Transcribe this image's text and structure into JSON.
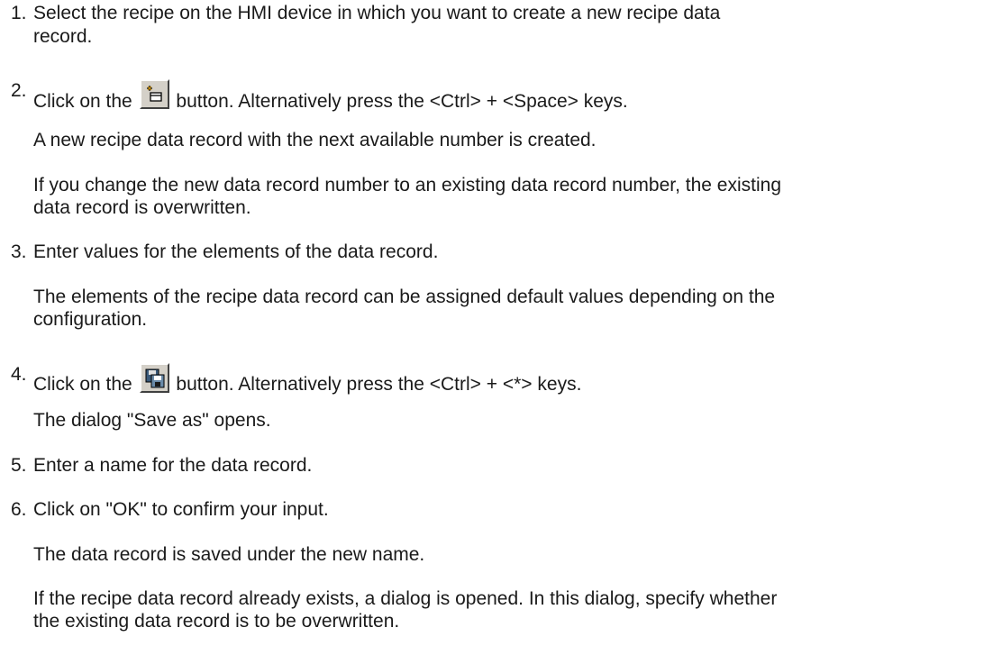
{
  "steps": [
    {
      "number": "1.",
      "lines": [
        "Select the recipe on the HMI device in which you want to create a new recipe data",
        "record."
      ]
    },
    {
      "number": "2.",
      "before": "Click on the",
      "after": "button. Alternatively press the <Ctrl> + <Space> keys.",
      "icon": "new-record-icon"
    },
    {
      "number": "3.",
      "text": "Enter values for the elements of the data record."
    },
    {
      "number": "4.",
      "before": "Click on the",
      "after": "button. Alternatively press the <Ctrl> + <*> keys.",
      "icon": "save-record-icon"
    },
    {
      "number": "5.",
      "text": "Enter a name for the data record."
    },
    {
      "number": "6.",
      "text": "Click on \"OK\" to confirm your input."
    }
  ],
  "results": {
    "r2a": "A new recipe data record with the next available number is created.",
    "r2b": [
      "If you change the new data record number to an existing data record number, the existing",
      "data record is overwritten."
    ],
    "r3": [
      "The elements of the recipe data record can be assigned default values depending on the",
      "configuration."
    ],
    "r4": "The dialog \"Save as\" opens.",
    "r6a": "The data record is saved under the new name.",
    "r6b": [
      "If the recipe data record already exists, a dialog is opened. In this dialog, specify whether",
      "the existing data record is to be overwritten."
    ]
  }
}
